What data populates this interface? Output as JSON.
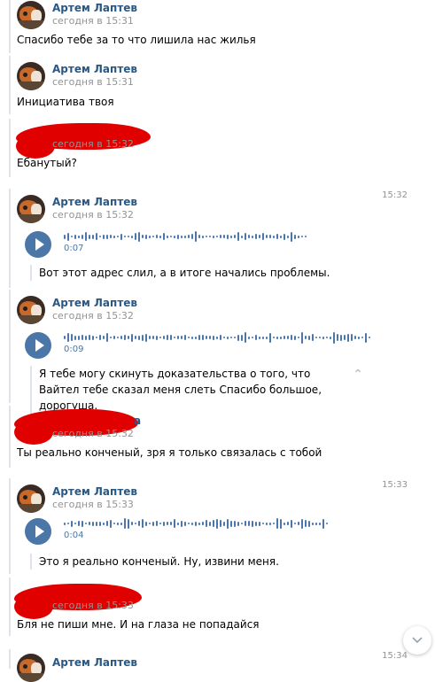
{
  "messages": [
    {
      "author": "Артем Лаптев",
      "time": "сегодня в 15:31",
      "text": "Спасибо тебе за то что лишила нас жилья"
    },
    {
      "author": "Артем Лаптев",
      "time": "сегодня в 15:31",
      "text": "Инициатива твоя"
    },
    {
      "author": "",
      "time": "сегодня в 15:32",
      "text": "Ебанутый?"
    },
    {
      "author": "Артем Лаптев",
      "time": "сегодня в 15:32",
      "stamp": "15:32",
      "voice_duration": "0:07",
      "transcript": "Вот этот адрес слил, а в итоге начались проблемы."
    },
    {
      "author": "Артем Лаптев",
      "time": "сегодня в 15:32",
      "voice_duration": "0:09",
      "transcript": "Я тебе могу скинуть доказательства о того, что Вайтел тебе сказал меня слеть Спасибо большое, дорогуша."
    },
    {
      "author_tail": "а",
      "time": "сегодня в 15:32",
      "text": "Ты реально конченый, зря я только связалась с тобой"
    },
    {
      "author": "Артем Лаптев",
      "time": "сегодня в 15:33",
      "stamp": "15:33",
      "voice_duration": "0:04",
      "transcript": "Это я реально конченый. Ну, извини меня."
    },
    {
      "author": "",
      "time": "сегодня в 15:33",
      "text": "Бля не пиши мне. И на глаза не попадайся"
    },
    {
      "author": "Артем Лаптев",
      "stamp": "15:34"
    }
  ],
  "icons": {
    "play": "play-icon",
    "collapse": "chevron-up-icon",
    "scroll": "chevron-down-icon"
  },
  "colors": {
    "link": "#2a5885",
    "accent": "#4a76a8",
    "muted": "#939393",
    "redaction": "#e00000"
  }
}
